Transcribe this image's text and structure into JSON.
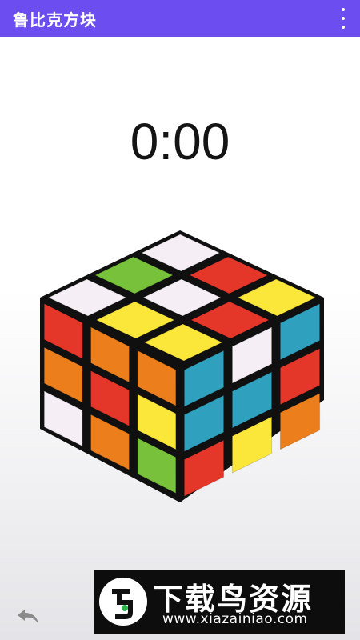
{
  "app": {
    "title": "鲁比克方块"
  },
  "timer": {
    "value": "0:00"
  },
  "colors": {
    "appbar": "#6c4ef0",
    "cube_body": "#101010",
    "white": "#f5eef5",
    "red": "#e5362a",
    "green": "#78c13a",
    "yellow": "#fbe73a",
    "orange": "#ec7f1c",
    "blue": "#2fa0bd"
  },
  "cube": {
    "top": [
      [
        "white",
        "red",
        "yellow"
      ],
      [
        "green",
        "white",
        "red"
      ],
      [
        "white",
        "yellow",
        "yellow"
      ]
    ],
    "left": [
      [
        "red",
        "orange",
        "orange"
      ],
      [
        "orange",
        "red",
        "yellow"
      ],
      [
        "white",
        "orange",
        "green"
      ]
    ],
    "right": [
      [
        "blue",
        "white",
        "blue"
      ],
      [
        "blue",
        "blue",
        "red"
      ],
      [
        "red",
        "yellow",
        "orange"
      ]
    ]
  },
  "icons": {
    "menu": "more-vert-icon",
    "undo": "undo-icon"
  },
  "ad": {
    "title": "下载鸟资源",
    "url": "www.xiazainiao.com"
  }
}
